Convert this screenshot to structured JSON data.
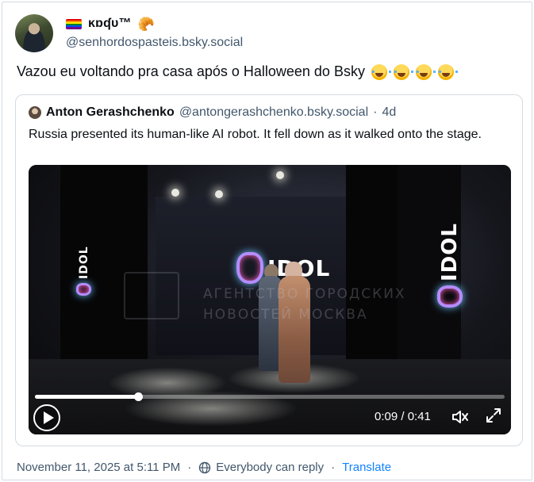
{
  "post": {
    "display_name": "ĸɒʠυ™",
    "handle": "@senhordospasteis.bsky.social",
    "text": "Vazou eu voltando pra casa após o Halloween do Bsky",
    "emojis": [
      "laughing-tears",
      "laughing-tears",
      "laughing-tears",
      "laughing-tears"
    ],
    "flag_colors": [
      "#e40303",
      "#ff8c00",
      "#ffed00",
      "#008026",
      "#004dff",
      "#750787"
    ]
  },
  "quote": {
    "display_name": "Anton Gerashchenko",
    "handle": "@antongerashchenko.bsky.social",
    "separator": "·",
    "age": "4d",
    "text": "Russia presented its human-like AI robot. It fell down as it walked onto the stage."
  },
  "video": {
    "logo_text": "IDOL",
    "watermark_line1": "АГЕНТСТВО ГОРОДСКИХ",
    "watermark_line2": "НОВОСТЕЙ МОСКВА",
    "time": "0:09 / 0:41",
    "progress_fraction": 0.22,
    "play_icon": "play-icon",
    "volume_icon": "volume-icon",
    "fullscreen_icon": "fullscreen-icon"
  },
  "footer": {
    "timestamp": "November 11, 2025 at 5:11 PM",
    "separator": "·",
    "reply_setting": "Everybody can reply",
    "translate": "Translate"
  },
  "colors": {
    "text": "#0b0f14",
    "muted": "#42576c",
    "link": "#1083fe",
    "border": "#d4dbe2"
  }
}
